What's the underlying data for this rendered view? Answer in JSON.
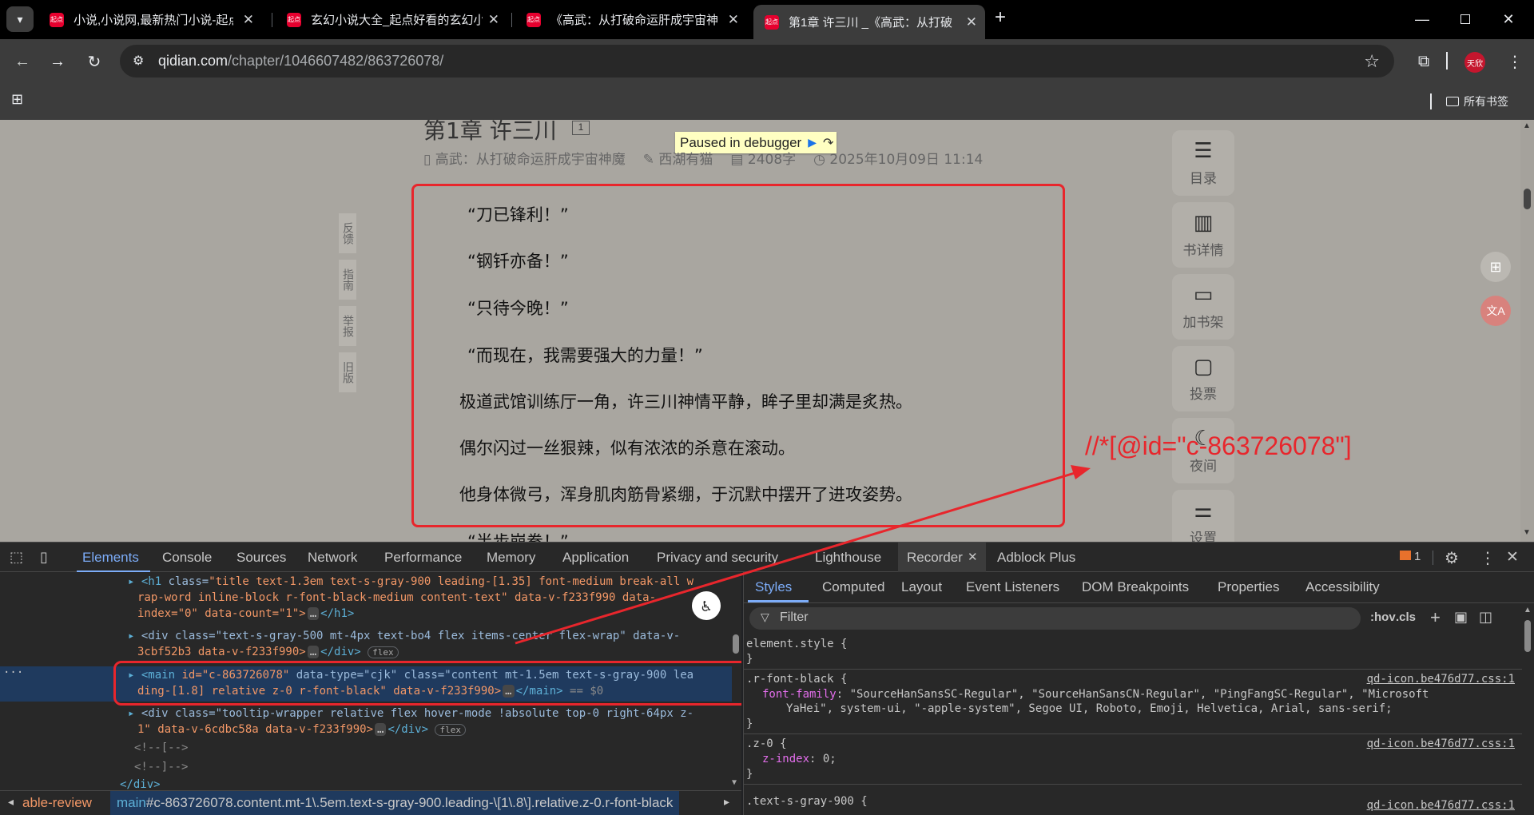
{
  "browser": {
    "tabs": [
      {
        "title": "小说,小说网,最新热门小说-起点",
        "favicon": "起点"
      },
      {
        "title": "玄幻小说大全_起点好看的玄幻小",
        "favicon": "起点"
      },
      {
        "title": "《高武：从打破命运肝成宇宙神",
        "favicon": "起点"
      },
      {
        "title": "第1章 许三川 _《高武：从打破",
        "favicon": "起点"
      }
    ],
    "new_tab": "+",
    "url_host": "qidian.com",
    "url_path": "/chapter/1046607482/863726078/",
    "profile": "天欣",
    "bookmarks_all": "所有书签"
  },
  "page": {
    "chapter_title": "第1章 许三川",
    "chapter_badge": "1",
    "debugger_banner": "Paused in debugger",
    "meta": {
      "book": "高武：从打破命运肝成宇宙神魔",
      "author": "西湖有猫",
      "words": "2408字",
      "date": "2025年10月09日 11:14"
    },
    "paragraphs": [
      "“刀已锋利！”",
      "“钢钎亦备！”",
      "“只待今晚！”",
      "“而现在，我需要强大的力量！”",
      "极道武馆训练厅一角，许三川神情平静，眸子里却满是炙热。",
      "偶尔闪过一丝狠辣，似有浓浓的杀意在滚动。",
      "他身体微弓，浑身肌肉筋骨紧绷，于沉默中摆开了进攻姿势。",
      "“半步崩拳！”"
    ],
    "left_links": [
      "反馈",
      "指南",
      "举报",
      "旧版"
    ],
    "right_panel": [
      {
        "label": "目录",
        "icon": "list-icon"
      },
      {
        "label": "书详情",
        "icon": "book-icon"
      },
      {
        "label": "加书架",
        "icon": "shelf-icon"
      },
      {
        "label": "投票",
        "icon": "vote-icon"
      },
      {
        "label": "夜间",
        "icon": "moon-icon"
      },
      {
        "label": "设置",
        "icon": "settings-icon"
      }
    ],
    "xpath_annotation": "//*[@id=\"c-863726078\"]"
  },
  "devtools": {
    "tabs": [
      "Elements",
      "Console",
      "Sources",
      "Network",
      "Performance",
      "Memory",
      "Application",
      "Privacy and security",
      "Lighthouse",
      "Recorder",
      "Adblock Plus"
    ],
    "active_tab": "Elements",
    "issues_count": "1",
    "code": {
      "l1a": "<h1",
      "l1_attr": "class=",
      "l1_val": "\"title text-1.3em text-s-gray-900 leading-[1.35] font-medium break-all w",
      "l2": "rap-word inline-block r-font-black-medium content-text\" data-v-f233f990 data-",
      "l3": "index=\"0\" data-count=\"1\">",
      "l3_end": "</h1>",
      "l4": "<div class=\"text-s-gray-500 mt-4px text-bo4 flex items-center flex-wrap\" data-v-",
      "l5": "3cbf52b3 data-v-f233f990>",
      "l5_end": "</div>",
      "flex_badge": "flex",
      "l6a": "<main",
      "l6_id": "id=\"c-863726078\"",
      "l6_rest": "data-type=\"cjk\" class=\"content mt-1.5em text-s-gray-900 lea",
      "l7": "ding-[1.8] relative z-0 r-font-black\" data-v-f233f990>",
      "l7_end": "</main>",
      "l7_dollar": "== $0",
      "l8": "<div class=\"tooltip-wrapper relative flex hover-mode !absolute top-0 right-64px z-",
      "l9": "1\" data-v-6cdbc58a data-v-f233f990>",
      "l9_end": "</div>",
      "l10": "<!--[-->",
      "l11": "<!--]-->",
      "l12": "</div>",
      "ellipsis": "…",
      "row_dots": "..."
    },
    "styles_tabs": [
      "Styles",
      "Computed",
      "Layout",
      "Event Listeners",
      "DOM Breakpoints",
      "Properties",
      "Accessibility"
    ],
    "filter_placeholder": "Filter",
    "hov": ":hov",
    "cls": ".cls",
    "rules": {
      "element_style": "element.style {",
      "close": "}",
      "r1_selector": ".r-font-black {",
      "r1_prop": "font-family",
      "r1_val": ": \"SourceHanSansSC-Regular\", \"SourceHanSansCN-Regular\", \"PingFangSC-Regular\", \"Microsoft",
      "r1_val2": "YaHei\", system-ui, \"-apple-system\", Segoe UI, Roboto, Emoji, Helvetica, Arial, sans-serif;",
      "r1_src": "qd-icon.be476d77.css:1",
      "r2_selector": ".z-0 {",
      "r2_prop": "z-index",
      "r2_val": ": 0;",
      "r2_src": "qd-icon.be476d77.css:1",
      "r3_selector": ".text-s-gray-900 {",
      "r3_src": "qd-icon.be476d77.css:1"
    },
    "breadcrumb_left": "able-review",
    "breadcrumb_main": "main",
    "breadcrumb_rest": "#c-863726078.content.mt-1\\.5em.text-s-gray-900.leading-\\[1\\.8\\].relative.z-0.r-font-black"
  },
  "colors": {
    "annotation_red": "#e8262c",
    "active_blue": "#7cacf8",
    "page_dim": "#a9a6a0"
  }
}
